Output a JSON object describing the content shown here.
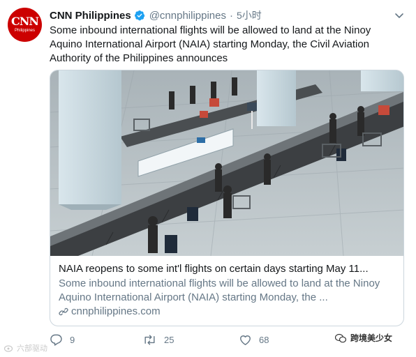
{
  "account": {
    "avatar_logo": "CNN",
    "avatar_sub": "Philippines",
    "name": "CNN Philippines",
    "handle": "@cnnphilippines",
    "separator": "·",
    "time": "5小时"
  },
  "tweet": {
    "text": "Some inbound international flights will be allowed to land at the Ninoy Aquino International Airport (NAIA) starting Monday, the Civil Aviation Authority of the Philippines announces"
  },
  "card": {
    "title": "NAIA reopens to some int'l flights on certain days starting May 11...",
    "description": "Some inbound international flights will be allowed to land at the Ninoy Aquino International Airport (NAIA) starting Monday, the ...",
    "domain": "cnnphilippines.com"
  },
  "actions": {
    "reply_count": "9",
    "retweet_count": "25",
    "like_count": "68"
  },
  "watermarks": {
    "left": "六部驱动",
    "right": "跨境美少女"
  },
  "colors": {
    "avatar_bg": "#cc0000",
    "verified": "#1da1f2",
    "secondary_text": "#657786",
    "border": "#ccd6dd"
  }
}
